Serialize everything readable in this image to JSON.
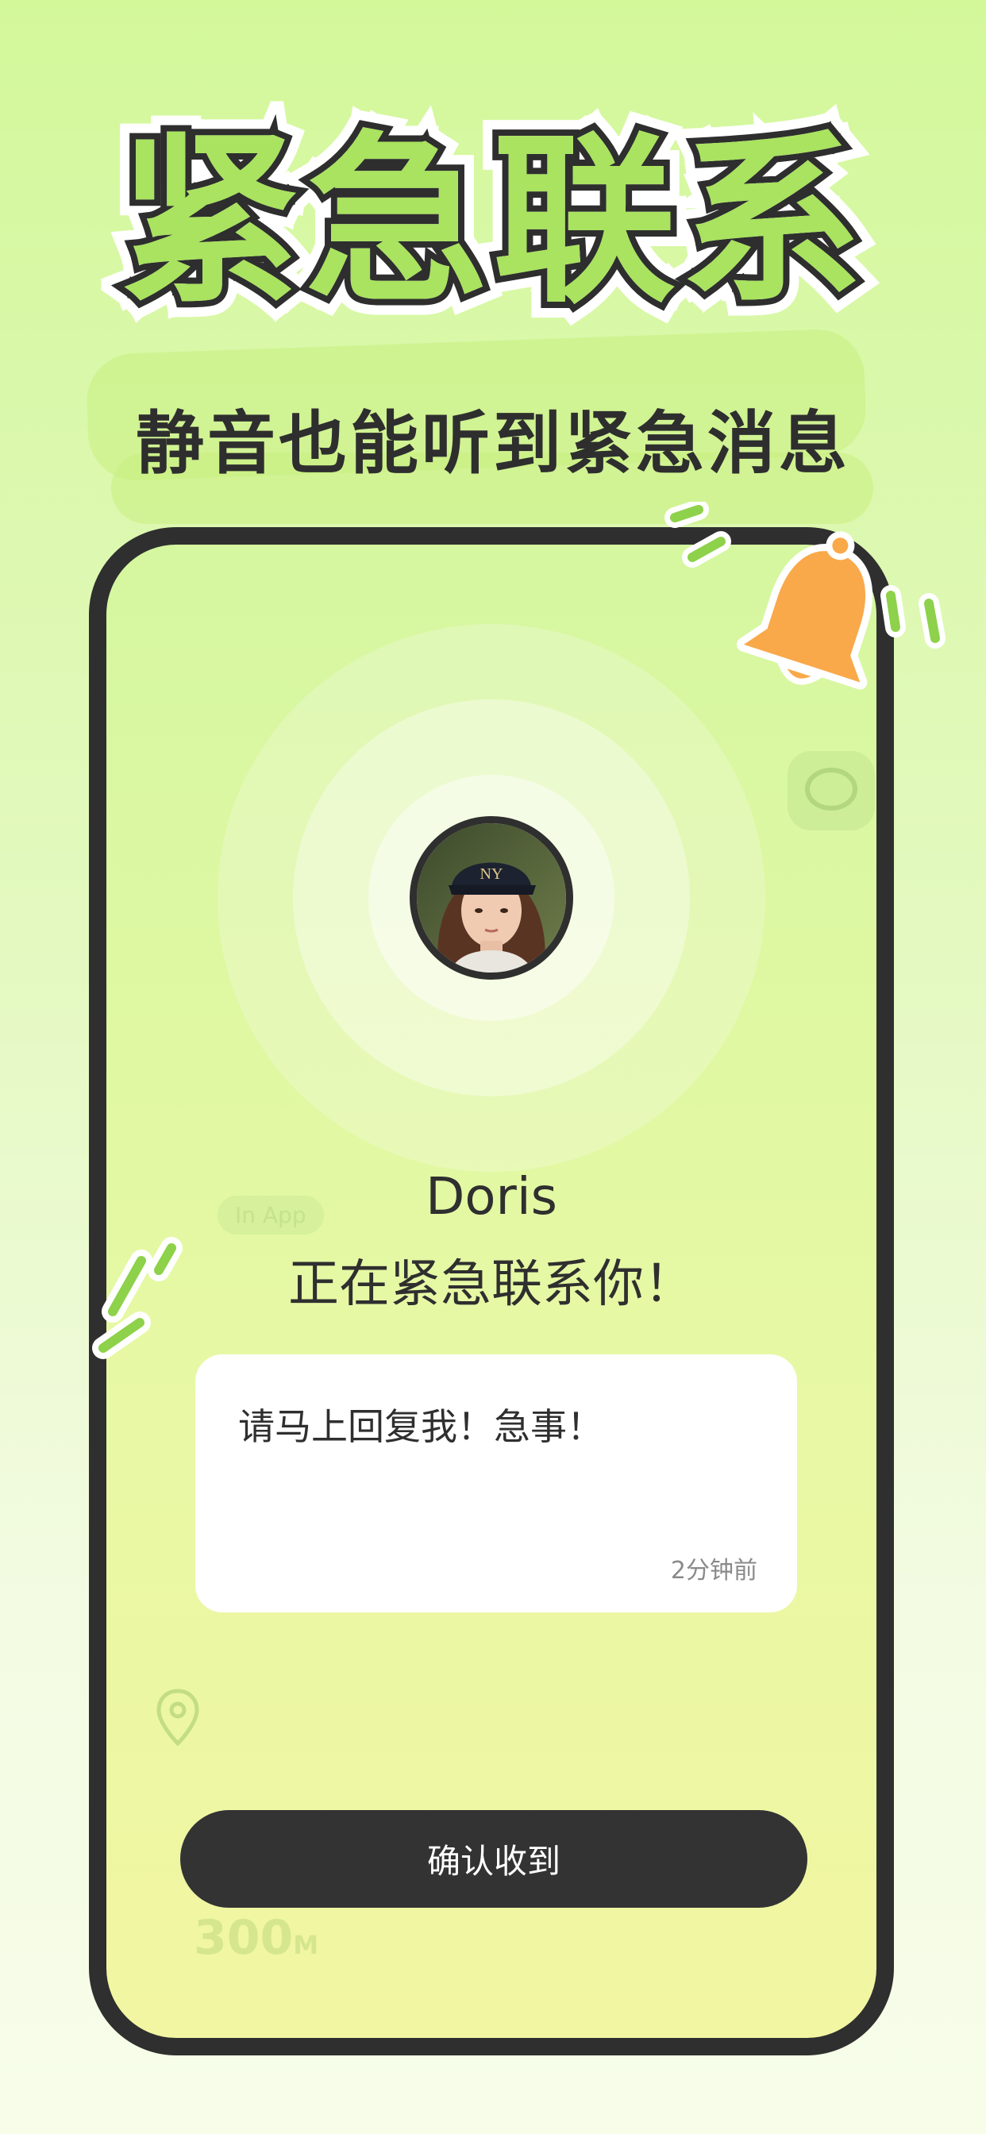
{
  "header": {
    "headline": "紧急联系",
    "subtitle": "静音也能听到紧急消息"
  },
  "alert": {
    "contact_name": "Doris",
    "status_text": "正在紧急联系你！",
    "message": "请马上回复我！急事！",
    "time": "2分钟前",
    "confirm_label": "确认收到"
  },
  "background": {
    "tag": "In App",
    "distance": "300",
    "distance_unit": "M"
  },
  "icons": {
    "bell": "bell-icon",
    "avatar": "avatar",
    "location": "location-pin-icon",
    "chat": "chat-bubble-icon"
  },
  "colors": {
    "accent_green": "#a9e35f",
    "bell_orange": "#f9a94a",
    "dark": "#2f2f2f",
    "button_bg": "#333333"
  }
}
